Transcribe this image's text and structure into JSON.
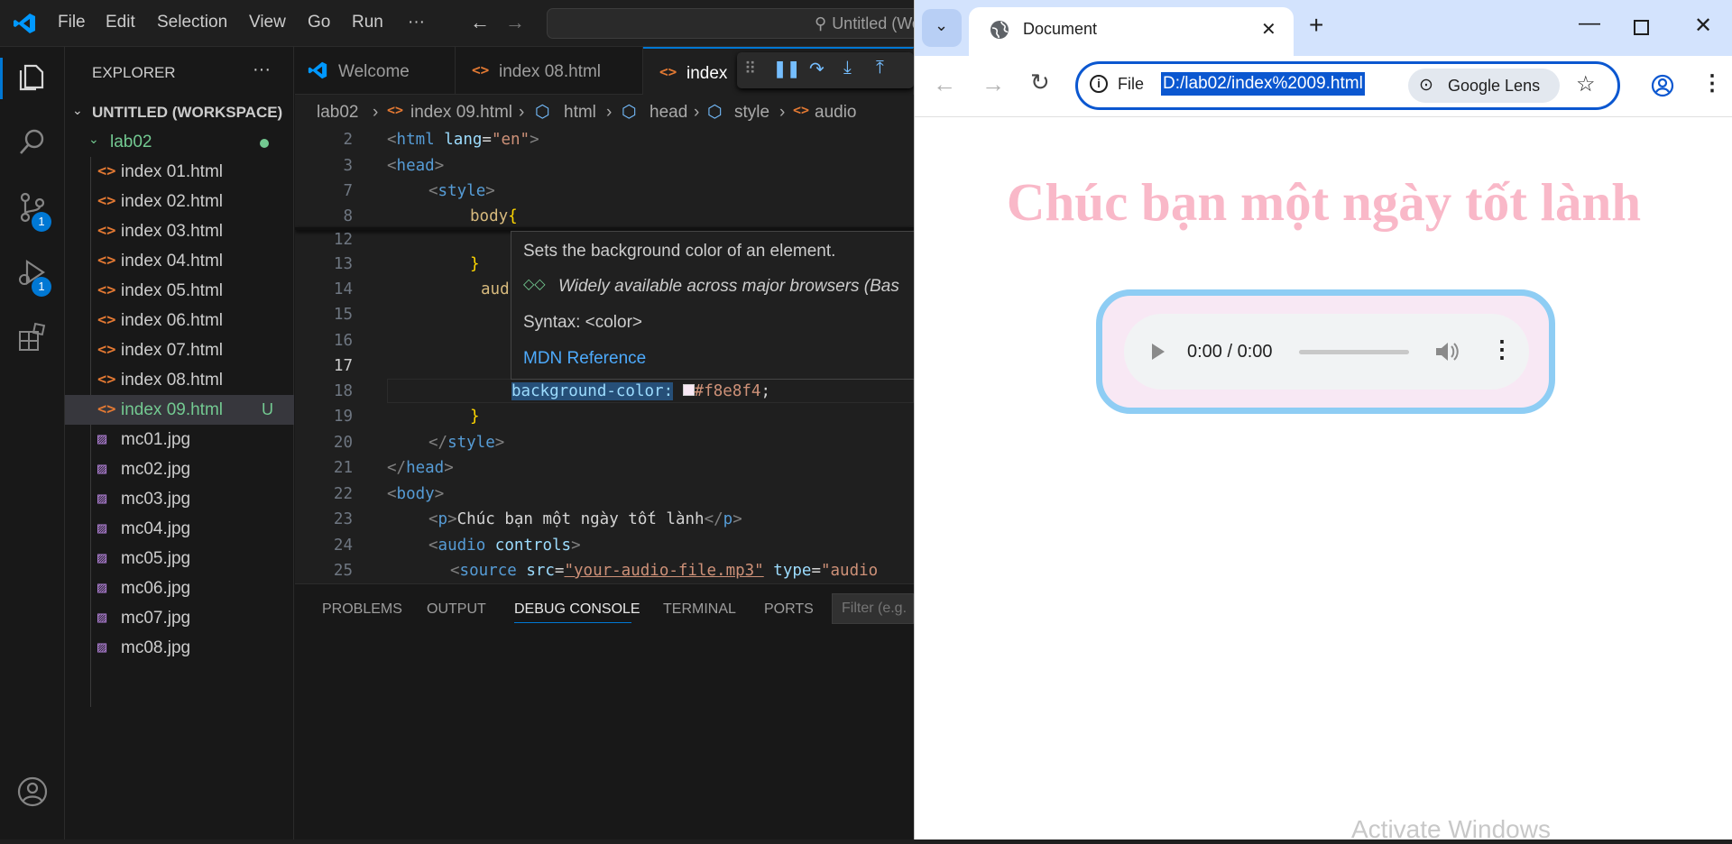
{
  "vscode": {
    "menu": [
      "File",
      "Edit",
      "Selection",
      "View",
      "Go",
      "Run",
      "···"
    ],
    "command_center": "Untitled (Workspace)",
    "activity_badges": {
      "source_control": "1",
      "run_debug": "1"
    },
    "explorer": {
      "title": "EXPLORER",
      "more": "···",
      "workspace": "UNTITLED (WORKSPACE)",
      "folder": "lab02",
      "files": [
        {
          "name": "index 01.html",
          "type": "html"
        },
        {
          "name": "index 02.html",
          "type": "html"
        },
        {
          "name": "index 03.html",
          "type": "html"
        },
        {
          "name": "index 04.html",
          "type": "html"
        },
        {
          "name": "index 05.html",
          "type": "html"
        },
        {
          "name": "index 06.html",
          "type": "html"
        },
        {
          "name": "index 07.html",
          "type": "html"
        },
        {
          "name": "index 08.html",
          "type": "html"
        },
        {
          "name": "index 09.html",
          "type": "html",
          "status": "U",
          "selected": true
        },
        {
          "name": "mc01.jpg",
          "type": "image"
        },
        {
          "name": "mc02.jpg",
          "type": "image"
        },
        {
          "name": "mc03.jpg",
          "type": "image"
        },
        {
          "name": "mc04.jpg",
          "type": "image"
        },
        {
          "name": "mc05.jpg",
          "type": "image"
        },
        {
          "name": "mc06.jpg",
          "type": "image"
        },
        {
          "name": "mc07.jpg",
          "type": "image"
        },
        {
          "name": "mc08.jpg",
          "type": "image"
        }
      ]
    },
    "tabs": [
      "Welcome",
      "index 08.html",
      "index"
    ],
    "breadcrumbs": [
      "lab02",
      "index 09.html",
      "html",
      "head",
      "style",
      "audio"
    ],
    "code_lines": [
      {
        "n": "2",
        "text": "<html lang=\"en\">"
      },
      {
        "n": "3",
        "text": "<head>"
      },
      {
        "n": "7",
        "text": "<style>"
      },
      {
        "n": "8",
        "text": "body{"
      },
      {
        "n": "12",
        "text": ""
      },
      {
        "n": "13",
        "text": "}"
      },
      {
        "n": "14",
        "text": "aud"
      },
      {
        "n": "15",
        "text": ""
      },
      {
        "n": "16",
        "text": ""
      },
      {
        "n": "17",
        "text": ""
      },
      {
        "n": "18",
        "text": "background-color: #f8e8f4;"
      },
      {
        "n": "19",
        "text": "}"
      },
      {
        "n": "20",
        "text": "</style>"
      },
      {
        "n": "21",
        "text": "</head>"
      },
      {
        "n": "22",
        "text": "<body>"
      },
      {
        "n": "23",
        "text": "<p>Chúc bạn một ngày tốt lành</p>"
      },
      {
        "n": "24",
        "text": "<audio controls>"
      },
      {
        "n": "25",
        "text": "<source src=\"your-audio-file.mp3\" type=\"audio"
      }
    ],
    "hover": {
      "description": "Sets the background color of an element.",
      "availability": "Widely available across major browsers (Bas",
      "syntax": "Syntax: <color>",
      "link": "MDN Reference"
    },
    "panel_tabs": [
      "PROBLEMS",
      "OUTPUT",
      "DEBUG CONSOLE",
      "TERMINAL",
      "PORTS"
    ],
    "panel_active": "DEBUG CONSOLE",
    "filter_placeholder": "Filter (e.g."
  },
  "chrome": {
    "tab_title": "Document",
    "site_info": "File",
    "url": "D:/lab02/index%2009.html",
    "lens": "Google Lens",
    "page": {
      "heading": "Chúc bạn một ngày tốt lành",
      "audio_time": "0:00 / 0:00"
    },
    "watermark": "Activate Windows"
  },
  "colors": {
    "accent": "#0078d4",
    "heading": "#f9b8c8",
    "audio_bg": "#f8e8f4",
    "audio_border": "#8ecdf4"
  }
}
